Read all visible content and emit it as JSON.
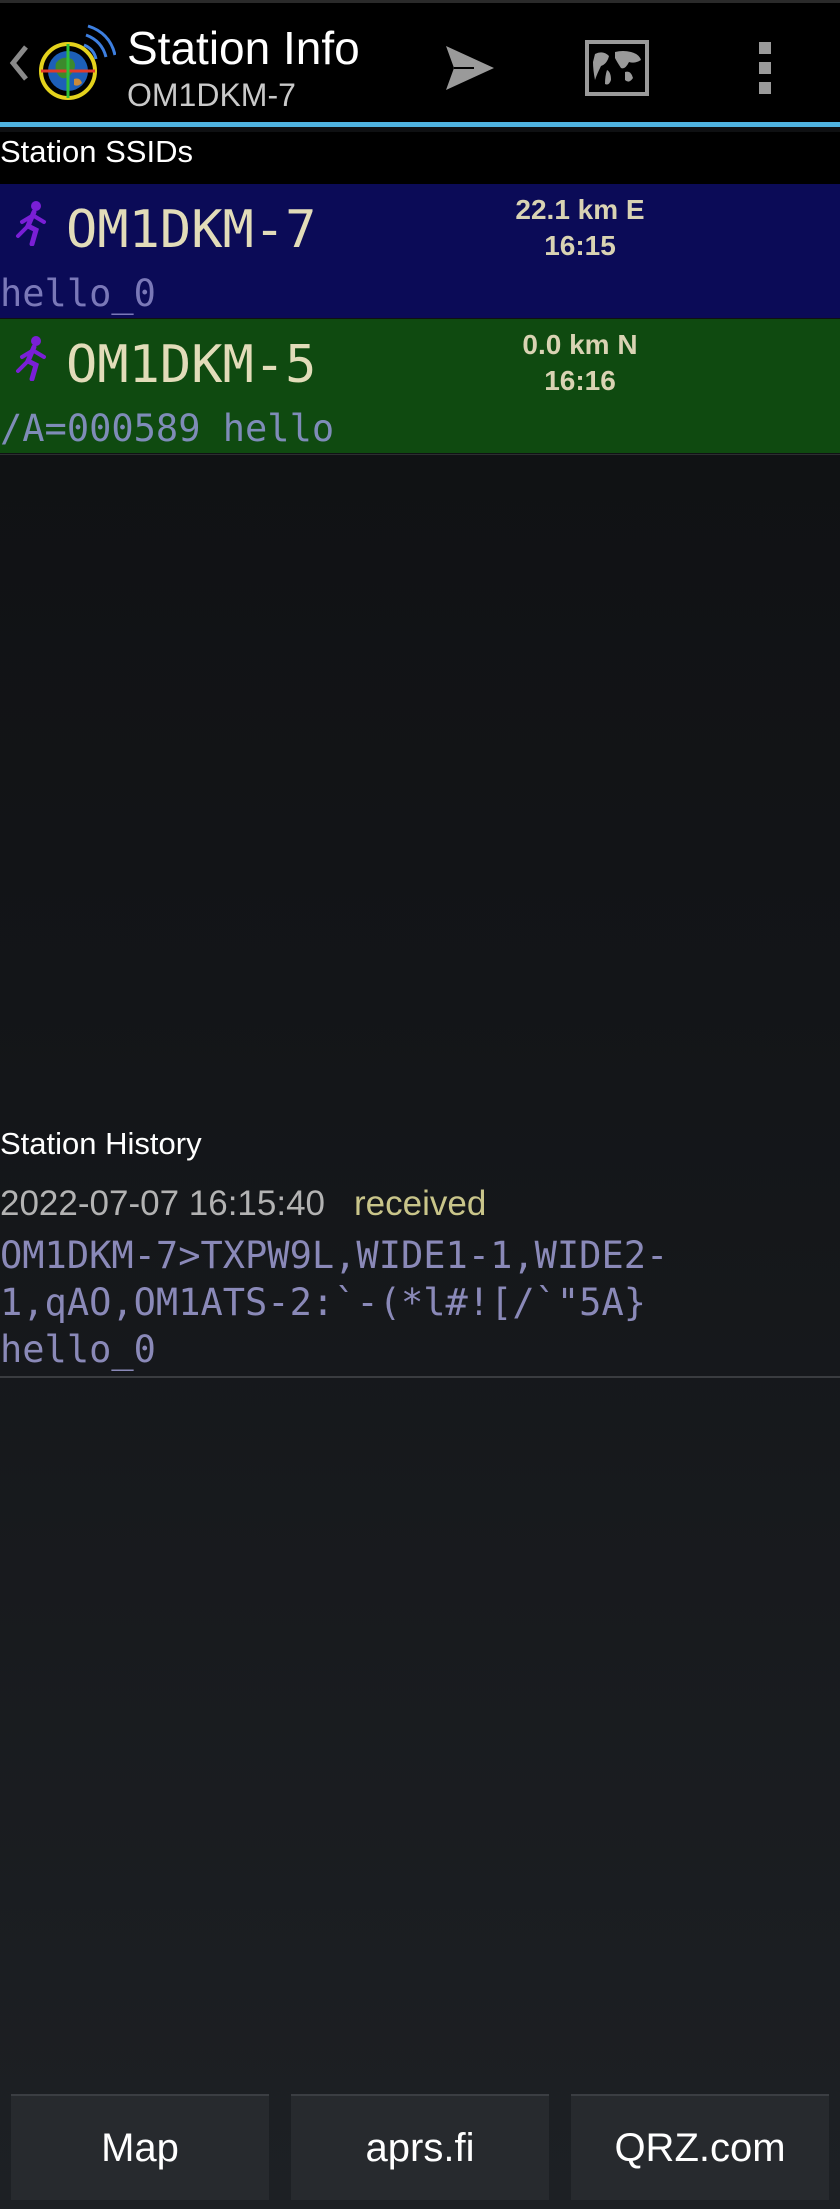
{
  "actionbar": {
    "title": "Station Info",
    "subtitle": "OM1DKM-7",
    "icons": {
      "up": "chevron-left-icon",
      "logo": "app-logo-icon",
      "send": "send-icon",
      "map": "world-map-icon",
      "overflow": "more-vertical-icon"
    },
    "accent_color": "#4fb3e0"
  },
  "ssids": {
    "header": "Station SSIDs",
    "items": [
      {
        "callsign": "OM1DKM-7",
        "distance": "22.1 km E",
        "time": "16:15",
        "comment": "hello_0",
        "icon": "runner-icon",
        "row_color": "#0b0b57"
      },
      {
        "callsign": "OM1DKM-5",
        "distance": "0.0 km N",
        "time": "16:16",
        "comment": "/A=000589 hello",
        "icon": "runner-icon",
        "row_color": "#0f4a10"
      }
    ]
  },
  "history": {
    "header": "Station History",
    "entries": [
      {
        "timestamp": "2022-07-07 16:15:40",
        "status": "received",
        "packet_lines": [
          "OM1DKM-7>TXPW9L,WIDE1-1,WIDE2-",
          "1,qAO,OM1ATS-2:`-(*l#![/`\"5A}",
          "hello_0"
        ]
      }
    ]
  },
  "bottom_bar": {
    "map_label": "Map",
    "aprs_label": "aprs.fi",
    "qrz_label": "QRZ.com"
  }
}
